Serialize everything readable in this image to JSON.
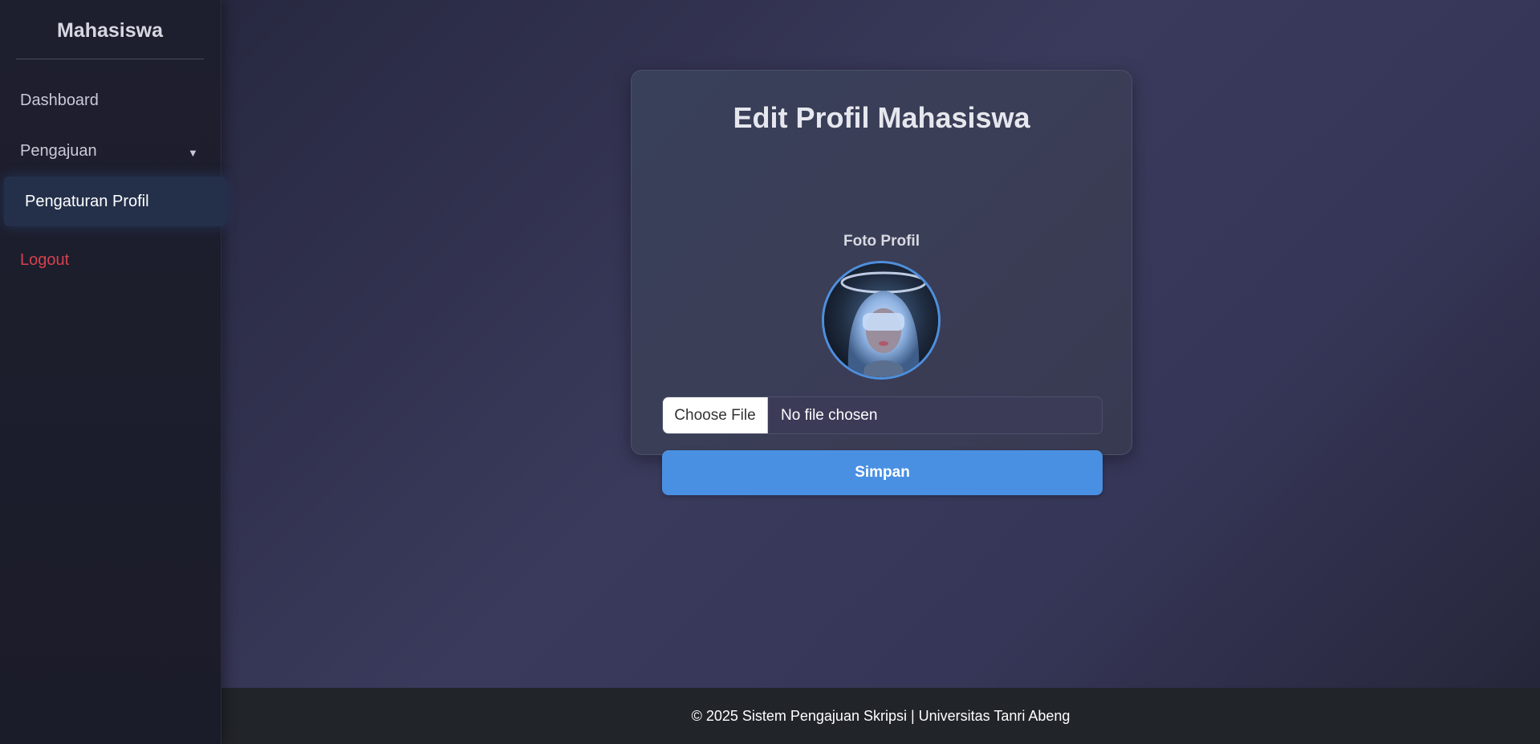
{
  "sidebar": {
    "title": "Mahasiswa",
    "items": [
      {
        "label": "Dashboard"
      },
      {
        "label": "Pengajuan",
        "icon": "caret-down-icon"
      },
      {
        "label": "Pengaturan Profil",
        "active": true
      },
      {
        "label": "Logout"
      }
    ]
  },
  "card": {
    "title": "Edit Profil Mahasiswa",
    "photo_label": "Foto Profil",
    "file_input": {
      "button_label": "Choose File",
      "status": "No file chosen"
    },
    "save_label": "Simpan"
  },
  "footer": {
    "text": "© 2025 Sistem Pengajuan Skripsi | Universitas Tanri Abeng"
  },
  "colors": {
    "accent": "#4a90e2",
    "logout": "#d6414f",
    "sidebar_bg": "#1e1f2e",
    "footer_bg": "#212429"
  }
}
